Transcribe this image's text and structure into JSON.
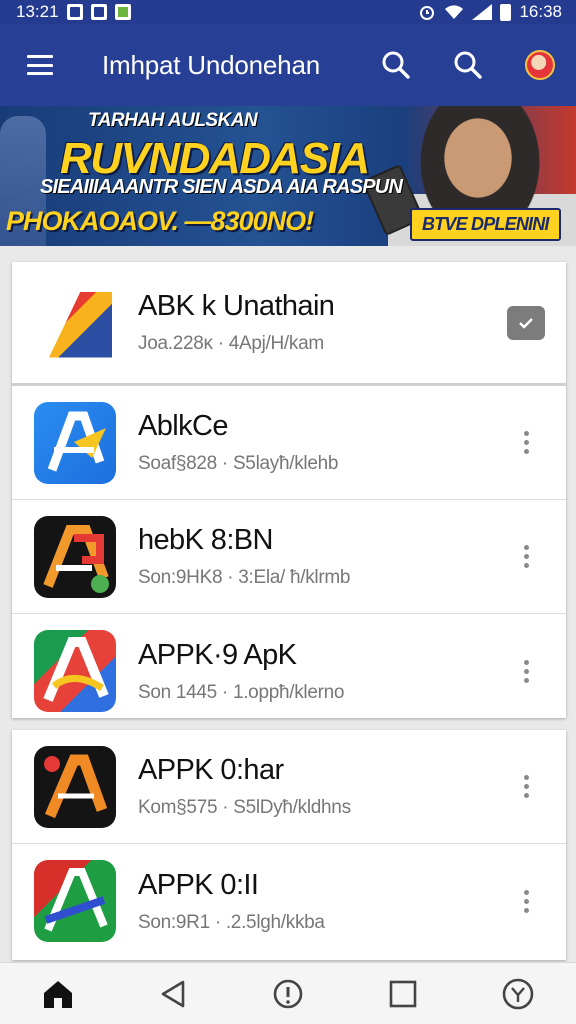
{
  "status_bar": {
    "time_left": "13:21",
    "time_right": "16:38"
  },
  "app_bar": {
    "title": "Imhpat Undonehan",
    "icons": [
      "menu-icon",
      "search-icon",
      "search-icon",
      "avatar"
    ]
  },
  "banner": {
    "kicker": "TARHAH AULSKAN",
    "headline": "RUVNDADASIA",
    "subline": "SIEAIIIAAANTR SIEN ASDA AIA RASPUN",
    "promo": "PHOKAOAOV. —8300NO!",
    "cta": "BTVE DPLENINI"
  },
  "apps": [
    {
      "name": "ABK k Unathain",
      "meta": "Joa.228ĸ · 4Apj/H/kam",
      "action": "install"
    },
    {
      "name": "AblkCe",
      "meta": "Soaf§828 · S5layħ/klehb",
      "action": "more"
    },
    {
      "name": "hebK 8:BN",
      "meta": "Son:9HK8 · 3:Ela/ ħ/klrmb",
      "action": "more"
    },
    {
      "name": "APPK·9 ApK",
      "meta": "Son 1445 · 1.oppħ/klerno",
      "action": "more"
    },
    {
      "name": "APPK 0:har",
      "meta": "Kom§575 · S5lDyħ/kldhns",
      "action": "more"
    },
    {
      "name": "APPK 0:II",
      "meta": "Son:9R1 · .2.5lgh/kkba",
      "action": "more"
    }
  ],
  "colors": {
    "app_bar": "#283f96",
    "status_bar": "#243b8f",
    "banner_yellow": "#ffd21f"
  },
  "bottom_nav": {
    "icons": [
      "home-icon",
      "back-icon",
      "info-icon",
      "recents-icon",
      "settings-icon"
    ]
  }
}
